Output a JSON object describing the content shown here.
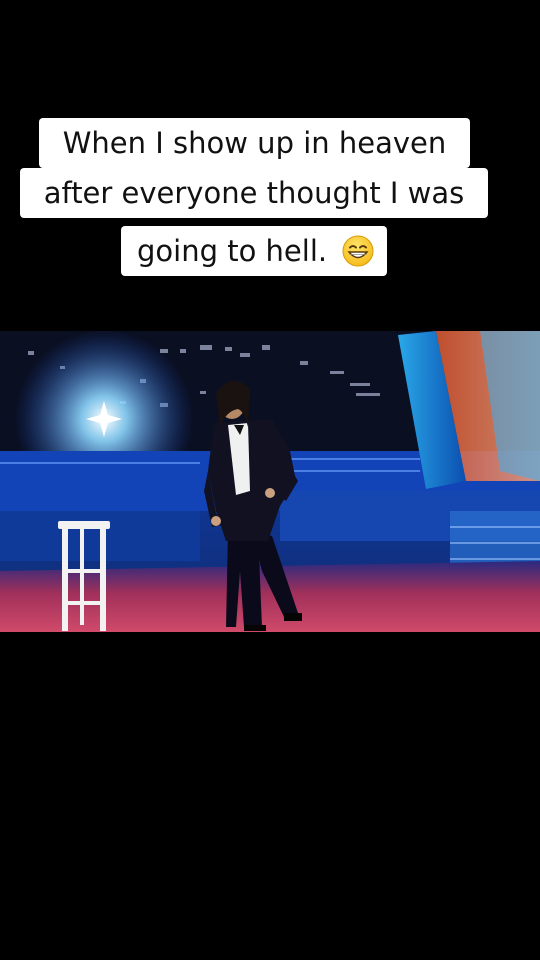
{
  "caption": {
    "line1": "When I show up in heaven",
    "line2": "after everyone thought I was",
    "line3": "going to hell."
  },
  "icons": {
    "caption_emoji": "grinning-squinting-face-emoji"
  },
  "colors": {
    "background": "#000000",
    "caption_bg": "#ffffff",
    "caption_text": "#111111",
    "stage_blue": "#1a4fd0",
    "stage_floor_red": "#c23a5a",
    "spotlight": "#ffffff"
  }
}
